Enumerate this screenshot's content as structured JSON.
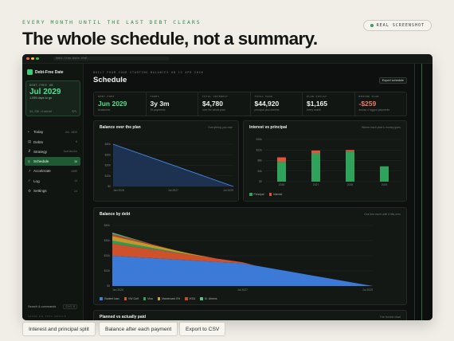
{
  "header": {
    "kicker": "EVERY MONTH UNTIL THE LAST DEBT CLEARS",
    "headline": "The whole schedule, not a summary.",
    "badge": "REAL SCREENSHOT"
  },
  "window": {
    "url": "debt-free-date.html"
  },
  "sidebar": {
    "brand": "Debt-Free Date",
    "card": {
      "label": "DEBT-FREE ON",
      "date": "Jul 2029",
      "sub": "1,095 days to go",
      "left": "$4,156 cleared",
      "right": "32%"
    },
    "nav": [
      {
        "icon": "•",
        "label": "Today",
        "meta": "JUL 2026"
      },
      {
        "icon": "▤",
        "label": "Debts",
        "meta": "6"
      },
      {
        "icon": "⇵",
        "label": "Strategy",
        "meta": "Avalanche"
      },
      {
        "icon": "≡",
        "label": "Schedule",
        "meta": "36"
      },
      {
        "icon": "↗",
        "label": "Accelerate",
        "meta": "$389"
      },
      {
        "icon": "✓",
        "label": "Log",
        "meta": "14"
      },
      {
        "icon": "⚙",
        "label": "Settings",
        "meta": "24"
      }
    ],
    "search": "Search & commands",
    "search_kbd": "Ctrl K",
    "footer": "SAVED ON THIS DEVICE"
  },
  "main": {
    "kicker": "BUILT FROM YOUR STARTING BALANCES ON 13 APR 2026",
    "title": "Schedule",
    "export_label": "Export schedule",
    "stats": [
      {
        "label": "DEBT-FREE",
        "value": "Jun 2029",
        "sub": "Avalanche",
        "color": "#4fe08a"
      },
      {
        "label": "TAKES",
        "value": "3y 3m",
        "sub": "39 payments",
        "color": "#eef2ee"
      },
      {
        "label": "TOTAL INTEREST",
        "value": "$4,780",
        "sub": "over the whole plan",
        "color": "#eef2ee"
      },
      {
        "label": "TOTAL PAID",
        "value": "$44,920",
        "sub": "principal plus interest",
        "color": "#eef2ee"
      },
      {
        "label": "PLAN OUTLAY",
        "value": "$1,165",
        "sub": "every month",
        "color": "#eef2ee"
      },
      {
        "label": "BEHIND PLAN",
        "value": "-$259",
        "sub": "across 4 logged payments",
        "color": "#f07a6a"
      }
    ]
  },
  "panels": {
    "balance": {
      "title": "Balance over the plan",
      "note": "Everything you owe"
    },
    "interest": {
      "title": "Interest vs principal",
      "note": "Where each year's money goes"
    },
    "bydebt": {
      "title": "Balance by debt",
      "note": "One line each until it hits zero"
    },
    "planned": {
      "title": "Planned vs actually paid",
      "note": "The honest chart"
    }
  },
  "chart_data": [
    {
      "type": "area",
      "title": "Balance over the plan",
      "x": [
        "Jan 2026",
        "Jul 2027",
        "Jul 2029"
      ],
      "y_ticks": [
        "$40k",
        "$30k",
        "$20k",
        "$10k",
        "$0"
      ],
      "ylim": [
        0,
        40000
      ],
      "series": [
        {
          "points": [
            [
              0,
              40000
            ],
            [
              1,
              0
            ]
          ]
        }
      ]
    },
    {
      "type": "bar",
      "title": "Interest vs principal",
      "categories": [
        "2026",
        "2027",
        "2028",
        "2029"
      ],
      "y_ticks": [
        "$16k",
        "$12k",
        "$8k",
        "$4k",
        "$0"
      ],
      "ylim": [
        0,
        16000
      ],
      "series": [
        {
          "name": "Principal",
          "values": [
            7500,
            10700,
            11400,
            5800
          ],
          "color": "#2fa35c"
        },
        {
          "name": "Interest",
          "values": [
            1700,
            1100,
            600,
            0
          ],
          "color": "#e0553a"
        }
      ]
    },
    {
      "type": "area",
      "title": "Balance by debt",
      "x": [
        "Jan 2026",
        "Jul 2027",
        "Jul 2029"
      ],
      "y_ticks": [
        "$40k",
        "$30k",
        "$20k",
        "$10k",
        "$0"
      ],
      "ylim": [
        0,
        40000
      ],
      "series": [
        {
          "name": "Student loan",
          "color": "#3d7fe0",
          "points": [
            [
              0,
              20000
            ],
            [
              0.5,
              15000
            ],
            [
              1,
              0
            ]
          ]
        },
        {
          "name": "VW Golf",
          "color": "#d9542c",
          "points": [
            [
              0,
              8000
            ],
            [
              0.55,
              0
            ]
          ]
        },
        {
          "name": "Visa",
          "color": "#2fa35c",
          "points": [
            [
              0,
              2000
            ],
            [
              0.3,
              0
            ]
          ]
        },
        {
          "name": "Mastercard 0%",
          "color": "#caa12e",
          "points": [
            [
              0,
              3000
            ],
            [
              0.4,
              0
            ]
          ]
        },
        {
          "name": "IKEA",
          "color": "#c7462e",
          "points": [
            [
              0,
              1500
            ],
            [
              0.25,
              0
            ]
          ]
        },
        {
          "name": "Dr. Ahrens",
          "color": "#4cc58a",
          "points": [
            [
              0,
              800
            ],
            [
              0.15,
              0
            ]
          ]
        }
      ]
    }
  ],
  "chips": [
    "Interest and principal split",
    "Balance after each payment",
    "Export to CSV"
  ]
}
